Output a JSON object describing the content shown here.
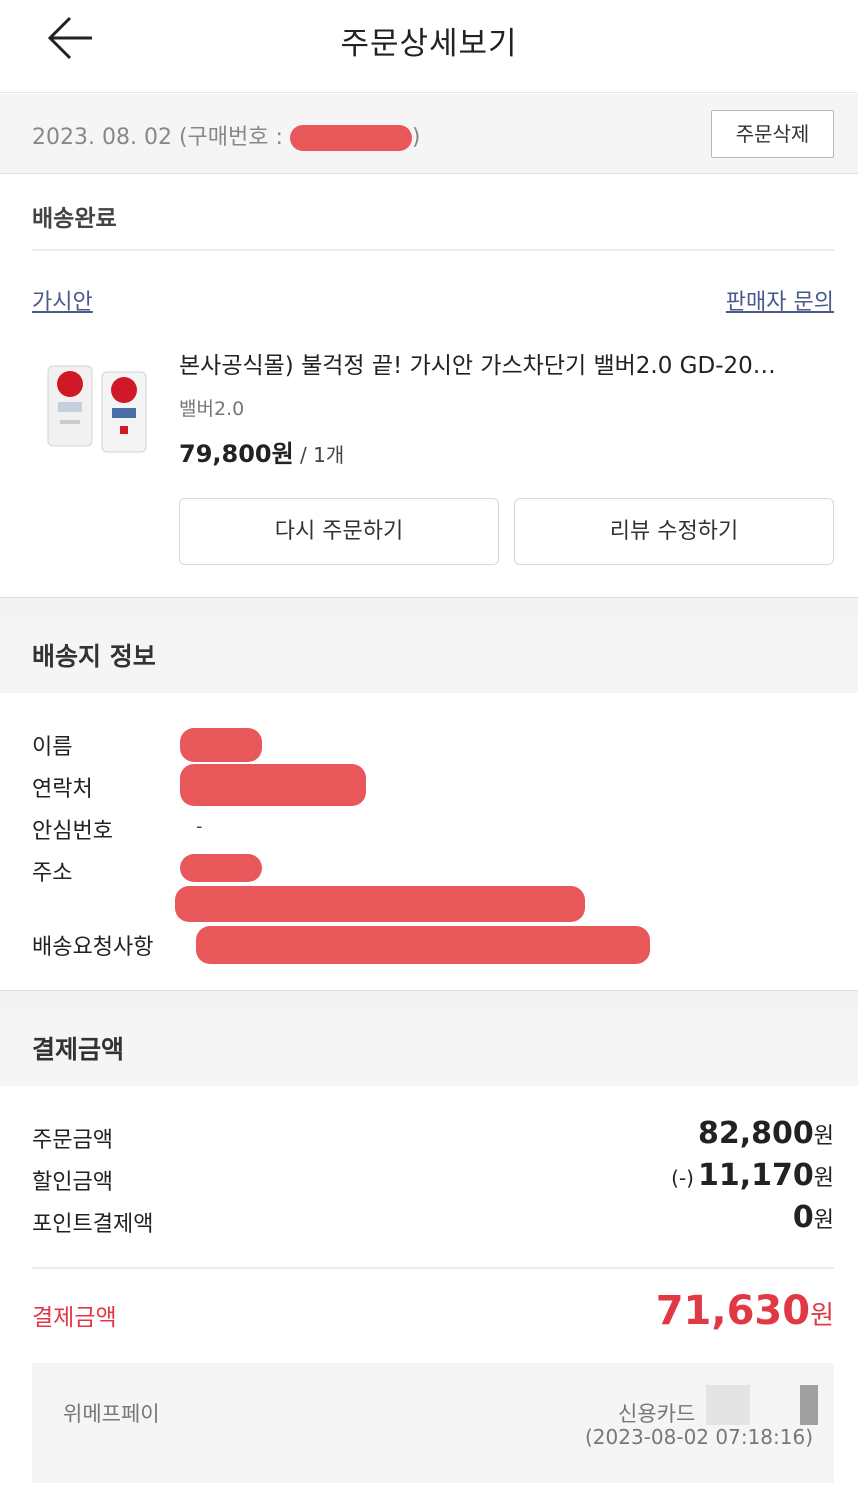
{
  "header": {
    "title": "주문상세보기"
  },
  "order": {
    "date_prefix": "2023. 08. 02 (구매번호 : ",
    "date_suffix": ")",
    "delete_label": "주문삭제"
  },
  "delivery": {
    "status": "배송완료",
    "seller": "가시안",
    "inquiry": "판매자 문의"
  },
  "product": {
    "name": "본사공식몰) 불걱정 끝! 가시안 가스차단기 밸버2.0 GD-20…",
    "option": "밸버2.0",
    "price": "79,800원",
    "qty": " / 1개",
    "reorder_label": "다시 주문하기",
    "review_label": "리뷰 수정하기"
  },
  "shipping": {
    "heading": "배송지 정보",
    "name_label": "이름",
    "phone_label": "연락처",
    "safe_number_label": "안심번호",
    "safe_number_value": "-",
    "address_label": "주소",
    "request_label": "배송요청사항"
  },
  "payment": {
    "heading": "결제금액",
    "order_amount_label": "주문금액",
    "order_amount": "82,800",
    "discount_label": "할인금액",
    "discount_prefix": "(-)",
    "discount": "11,170",
    "points_label": "포인트결제액",
    "points": "0",
    "won": "원",
    "total_label": "결제금액",
    "total": "71,630",
    "method_name": "위메프페이",
    "method_type": "신용카드",
    "paid_at": "(2023-08-02 07:18:16)"
  },
  "colors": {
    "accent_red": "#e03845",
    "link_blue": "#4a5a8a",
    "redaction": "#e8585a"
  }
}
